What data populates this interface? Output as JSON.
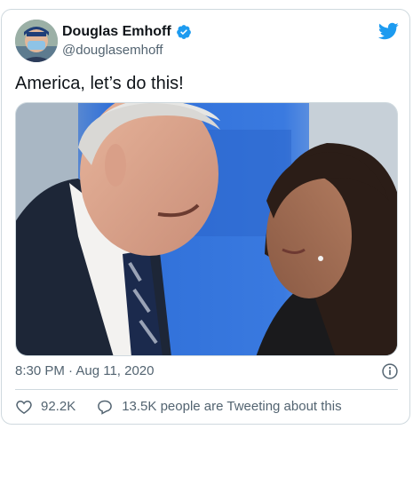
{
  "author": {
    "name": "Douglas Emhoff",
    "handle": "@douglasemhoff",
    "verified": true
  },
  "tweet": {
    "text": "America, let’s do this!",
    "timestamp": "8:30 PM · Aug 11, 2020"
  },
  "stats": {
    "likes": "92.2K",
    "conversation": "13.5K people are Tweeting about this"
  },
  "icons": {
    "brand": "twitter-bird-icon",
    "verified": "verified-badge-icon",
    "info": "info-icon",
    "like": "heart-icon",
    "reply": "speech-bubble-icon"
  },
  "colors": {
    "brand": "#1d9bf0",
    "text": "#0f1419",
    "secondary": "#536471",
    "border": "#cfd9de"
  }
}
